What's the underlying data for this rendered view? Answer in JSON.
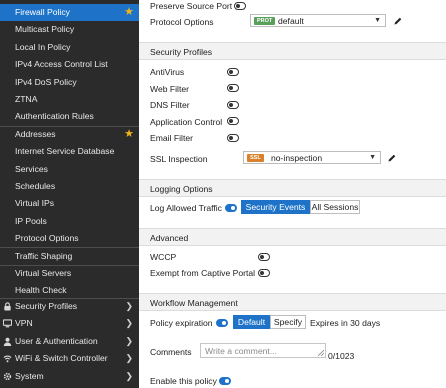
{
  "sidebar": {
    "items": [
      {
        "label": "Firewall Policy",
        "active": true,
        "starred": true
      },
      {
        "label": "Multicast Policy"
      },
      {
        "label": "Local In Policy"
      },
      {
        "label": "IPv4 Access Control List"
      },
      {
        "label": "IPv4 DoS Policy"
      },
      {
        "label": "ZTNA"
      },
      {
        "label": "Authentication Rules"
      },
      {
        "label": "Addresses",
        "starred": true
      },
      {
        "label": "Internet Service Database"
      },
      {
        "label": "Services"
      },
      {
        "label": "Schedules"
      },
      {
        "label": "Virtual IPs"
      },
      {
        "label": "IP Pools"
      },
      {
        "label": "Protocol Options"
      },
      {
        "label": "Traffic Shaping"
      },
      {
        "label": "Virtual Servers"
      },
      {
        "label": "Health Check"
      }
    ],
    "categories": [
      {
        "label": "Security Profiles",
        "icon": "lock-icon"
      },
      {
        "label": "VPN",
        "icon": "monitor-icon"
      },
      {
        "label": "User & Authentication",
        "icon": "user-icon"
      },
      {
        "label": "WiFi & Switch Controller",
        "icon": "wifi-icon"
      },
      {
        "label": "System",
        "icon": "gear-icon"
      }
    ]
  },
  "main": {
    "preserve_source_port": "Preserve Source Port",
    "protocol_options_label": "Protocol Options",
    "protocol_options_badge": "PROT",
    "protocol_options_value": "default",
    "security_profiles_header": "Security Profiles",
    "profiles": [
      "AntiVirus",
      "Web Filter",
      "DNS Filter",
      "Application Control",
      "Email Filter"
    ],
    "ssl_label": "SSL Inspection",
    "ssl_badge": "SSL",
    "ssl_value": "no-inspection",
    "logging_header": "Logging Options",
    "log_allowed_label": "Log Allowed Traffic",
    "log_security_events": "Security Events",
    "log_all_sessions": "All Sessions",
    "advanced_header": "Advanced",
    "wccp_label": "WCCP",
    "exempt_label": "Exempt from Captive Portal",
    "workflow_header": "Workflow Management",
    "policy_expiration_label": "Policy expiration",
    "expiration_default": "Default",
    "expiration_specify": "Specify",
    "expires_text": "Expires in 30 days",
    "comments_label": "Comments",
    "comments_placeholder": "Write a comment...",
    "comments_count": "0/1023",
    "enable_label": "Enable this policy"
  },
  "colors": {
    "accent": "#1e73c8",
    "sidebar_bg": "#2b2b2b",
    "prot_badge": "#5aa05a",
    "ssl_badge": "#d9822b",
    "star": "#f0b41c"
  }
}
